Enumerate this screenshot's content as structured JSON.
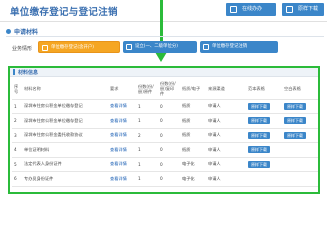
{
  "header": {
    "title": "单位缴存登记与登记注销",
    "btn_online": "在线办办",
    "btn_guide": "原样下载"
  },
  "section": {
    "title": "申请材料"
  },
  "business": {
    "label": "业务情形",
    "options": [
      "单位缴存登记(含开户)",
      "设立(一、二级单位分)",
      "单位缴存登记注销"
    ]
  },
  "materials": {
    "title": "材料信息",
    "columns": [
      "序号",
      "材料名称",
      "要求",
      "份数(份/册)原件",
      "份数(份/册)复印件",
      "纸质/电子",
      "来源渠道",
      "范本表格",
      "空白表格"
    ],
    "rows": [
      {
        "no": "1",
        "name": "深圳市住房公积金单位缴存登记",
        "req": "查看详情",
        "orig": "1",
        "copy": "0",
        "type": "纸质",
        "source": "申请人",
        "sample": "原样下载",
        "blank": "原样下载"
      },
      {
        "no": "2",
        "name": "深圳市住房公积金单位缴存登记",
        "req": "查看详情",
        "orig": "1",
        "copy": "0",
        "type": "纸质",
        "source": "申请人",
        "sample": "原样下载",
        "blank": "原样下载"
      },
      {
        "no": "3",
        "name": "深圳市住房公积金委托收款协议",
        "req": "查看详情",
        "orig": "2",
        "copy": "0",
        "type": "纸质",
        "source": "申请人",
        "sample": "原样下载",
        "blank": "原样下载"
      },
      {
        "no": "4",
        "name": "单位证明材料",
        "req": "查看详情",
        "orig": "1",
        "copy": "0",
        "type": "纸质",
        "source": "申请人",
        "sample": "原样下载",
        "blank": ""
      },
      {
        "no": "5",
        "name": "法定代表人身份证件",
        "req": "查看详情",
        "orig": "1",
        "copy": "0",
        "type": "电子化",
        "source": "申请人",
        "sample": "原样下载",
        "blank": ""
      },
      {
        "no": "6",
        "name": "专办员身份证件",
        "req": "查看详情",
        "orig": "1",
        "copy": "0",
        "type": "电子化",
        "source": "申请人",
        "sample": "",
        "blank": ""
      }
    ]
  },
  "colors": {
    "accent": "#3b86c9",
    "highlight": "#2bbb3a",
    "selected": "#f5a623"
  }
}
